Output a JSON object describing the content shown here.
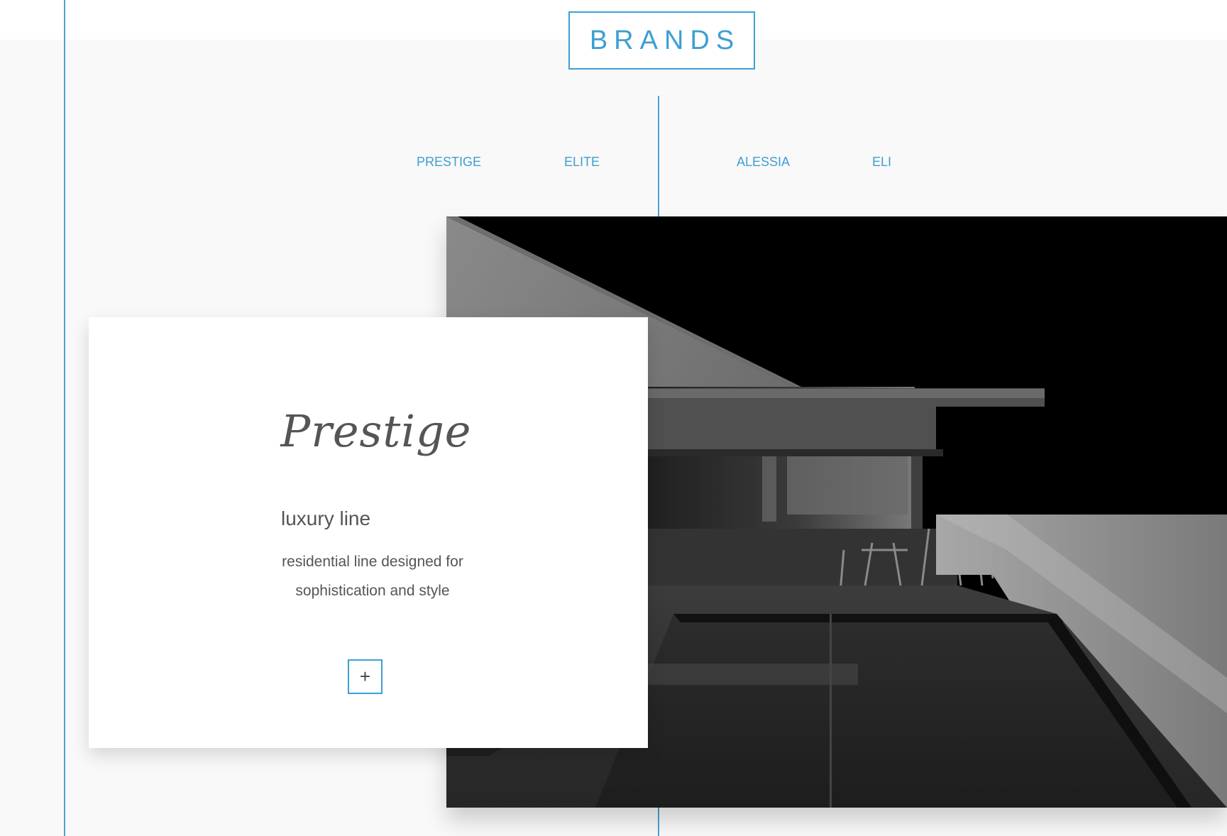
{
  "header": {
    "title": "BRANDS"
  },
  "brand_tabs": [
    {
      "label": "PRESTIGE"
    },
    {
      "label": "ELITE"
    },
    {
      "label": "ALESSIA"
    },
    {
      "label": "ELI"
    }
  ],
  "card": {
    "title": "Prestige",
    "subtitle": "luxury line",
    "description_line1": "residential line designed for",
    "description_line2": "sophistication and style",
    "plus_label": "+"
  },
  "colors": {
    "accent": "#3e9fd3",
    "text": "#555555",
    "background": "#f9f9f9"
  }
}
